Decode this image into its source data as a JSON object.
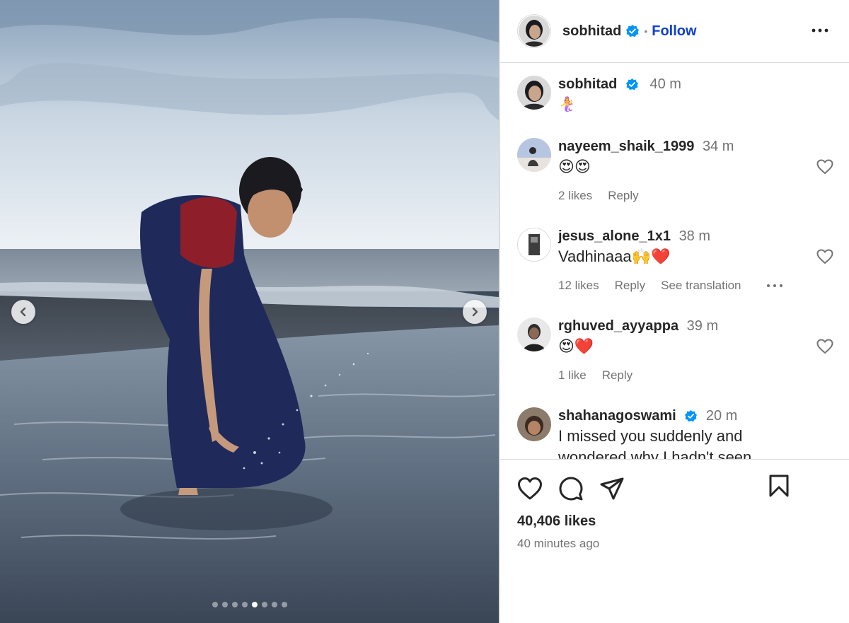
{
  "post": {
    "author": "sobhitad",
    "follow_label": "Follow",
    "carousel": {
      "total_slides": 8,
      "active_index": 4
    }
  },
  "caption": {
    "username": "sobhitad",
    "time": "40 m",
    "text": "🧜‍♀️"
  },
  "comments": [
    {
      "username": "nayeem_shaik_1999",
      "time": "34 m",
      "text": "😍😍",
      "likes": "2 likes",
      "reply": "Reply"
    },
    {
      "username": "jesus_alone_1x1",
      "time": "38 m",
      "text": "Vadhinaaa🙌❤️",
      "likes": "12 likes",
      "reply": "Reply",
      "translation": "See translation"
    },
    {
      "username": "rghuved_ayyappa",
      "time": "39 m",
      "text": "😍❤️",
      "likes": "1 like",
      "reply": "Reply"
    },
    {
      "username": "shahanagoswami",
      "time": "20 m",
      "text": "I missed you suddenly and wondered why I hadn't seen"
    }
  ],
  "footer": {
    "likes_count": "40,406 likes",
    "posted_ago": "40 minutes ago"
  },
  "icons": {
    "more": "more-horizontal-icon",
    "verified": "verified-badge-icon",
    "like": "heart-icon",
    "comment": "comment-icon",
    "share": "share-icon",
    "save": "bookmark-icon",
    "prev": "chevron-left-icon",
    "next": "chevron-right-icon"
  },
  "colors": {
    "follow": "#0f3fd1",
    "verified": "#0095f6",
    "muted": "#737373",
    "border": "#dbdbdb"
  }
}
